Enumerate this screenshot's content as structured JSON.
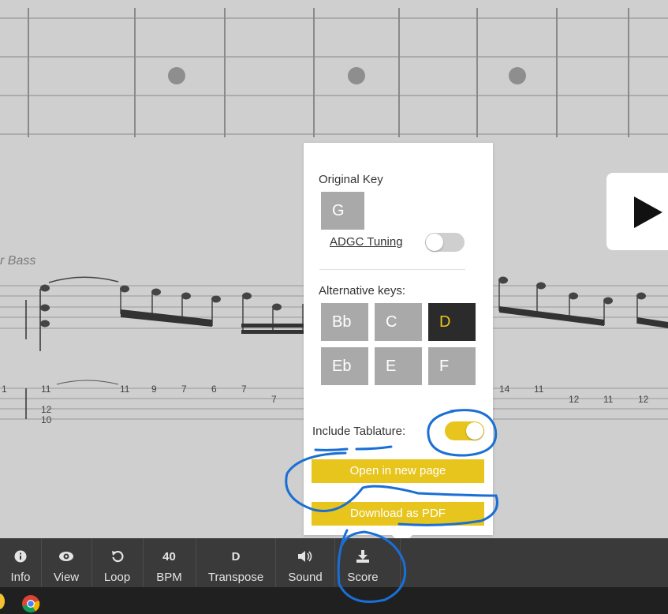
{
  "score": {
    "instrument_label": "r Bass",
    "tab_numbers": {
      "n1": "1",
      "n2": "11",
      "n3": "12",
      "n4": "10",
      "n5": "11",
      "n6": "9",
      "n7": "7",
      "n8": "6",
      "n9": "7",
      "n10": "7",
      "n11": "14",
      "n12": "11",
      "n13": "12",
      "n14": "11",
      "n15": "12"
    }
  },
  "popup": {
    "original_key_label": "Original Key",
    "original_key": "G",
    "tuning_label": "ADGC Tuning",
    "tuning_enabled": false,
    "alt_keys_label": "Alternative keys:",
    "alt_keys": [
      "Bb",
      "C",
      "D",
      "Eb",
      "E",
      "F"
    ],
    "selected_key": "D",
    "include_tab_label": "Include Tablature:",
    "include_tab_enabled": true,
    "open_button": "Open in new page",
    "download_button": "Download as PDF"
  },
  "toolbar": {
    "info": {
      "icon": "info-icon",
      "label": "Info"
    },
    "view": {
      "icon": "eye-icon",
      "label": "View"
    },
    "loop": {
      "icon": "loop-icon",
      "label": "Loop"
    },
    "bpm": {
      "value": "40",
      "label": "BPM"
    },
    "transpose": {
      "value": "D",
      "label": "Transpose"
    },
    "sound": {
      "icon": "speaker-icon",
      "label": "Sound"
    },
    "score": {
      "icon": "download-icon",
      "label": "Score"
    }
  },
  "colors": {
    "accent": "#e8c51c",
    "toolbar_bg": "#3a3a3a",
    "key_button": "#a9a9a9",
    "selected_key_bg": "#2b2b2b",
    "annotation": "#1a6fd6"
  }
}
